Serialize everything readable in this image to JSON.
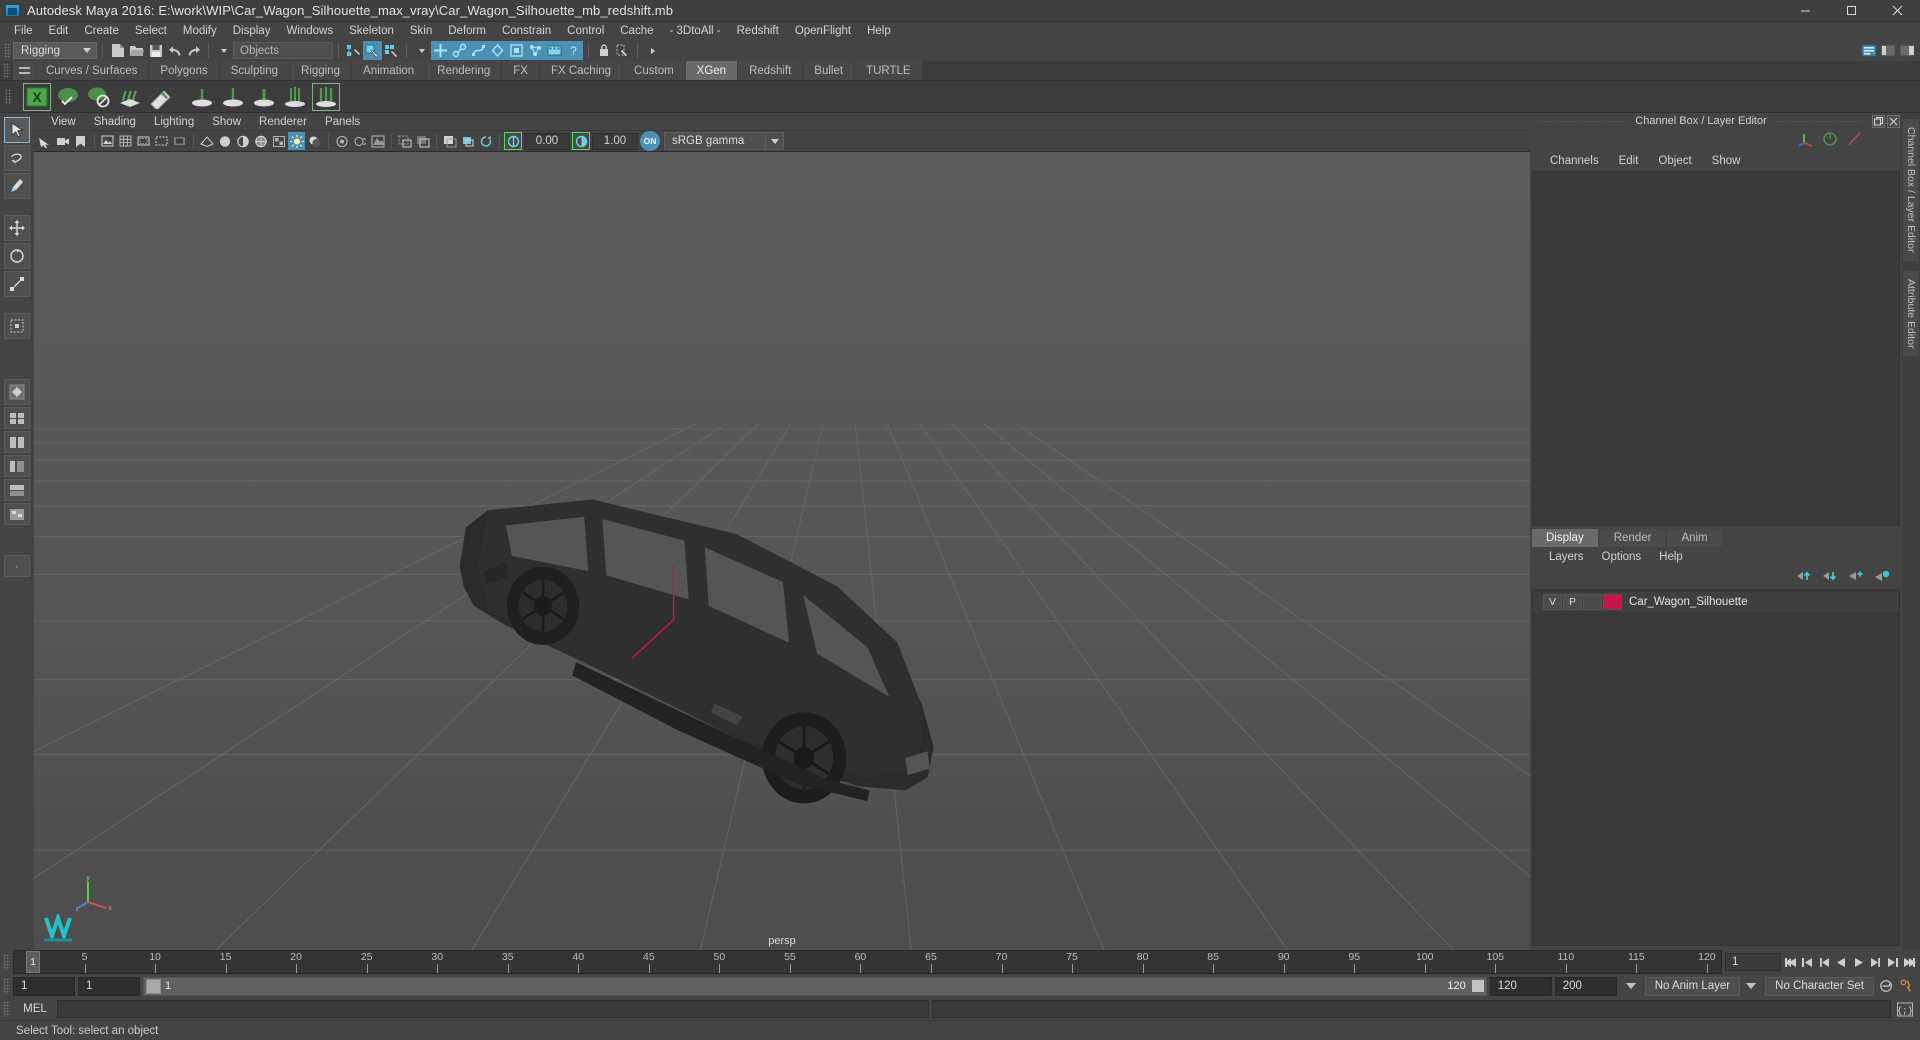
{
  "window": {
    "title": "Autodesk Maya 2016: E:\\work\\WIP\\Car_Wagon_Silhouette_max_vray\\Car_Wagon_Silhouette_mb_redshift.mb",
    "minimize": "minimize-button",
    "maximize": "maximize-button",
    "close": "close-button"
  },
  "menubar": {
    "items": [
      "File",
      "Edit",
      "Create",
      "Select",
      "Modify",
      "Display",
      "Windows",
      "Skeleton",
      "Skin",
      "Deform",
      "Constrain",
      "Control",
      "Cache",
      "- 3DtoAll -",
      "Redshift",
      "OpenFlight",
      "Help"
    ]
  },
  "toolbar": {
    "menuset": "Rigging",
    "selection_mask": "Objects"
  },
  "shelf": {
    "tabs": [
      "Curves / Surfaces",
      "Polygons",
      "Sculpting",
      "Rigging",
      "Animation",
      "Rendering",
      "FX",
      "FX Caching",
      "Custom",
      "XGen",
      "Redshift",
      "Bullet",
      "TURTLE"
    ],
    "active_tab": "XGen"
  },
  "viewport": {
    "menus": [
      "View",
      "Shading",
      "Lighting",
      "Show",
      "Renderer",
      "Panels"
    ],
    "exposure": "0.00",
    "gamma": "1.00",
    "cms_toggle": "ON",
    "color_profile": "sRGB gamma",
    "camera_label": "persp"
  },
  "right_dock": {
    "panel_title": "Channel Box / Layer Editor",
    "channel_tabs": [
      "Channels",
      "Edit",
      "Object",
      "Show"
    ],
    "layer_editor_tabs": [
      "Display",
      "Render",
      "Anim"
    ],
    "layer_editor_active_tab": "Display",
    "layer_menus": [
      "Layers",
      "Options",
      "Help"
    ],
    "layers": [
      {
        "visibility": "V",
        "playback": "P",
        "shading": "",
        "color": "#c8144b",
        "name": "Car_Wagon_Silhouette"
      }
    ],
    "vertical_tabs": [
      "Channel Box / Layer Editor",
      "Attribute Editor"
    ]
  },
  "timeline": {
    "ticks": [
      5,
      10,
      15,
      20,
      25,
      30,
      35,
      40,
      45,
      50,
      55,
      60,
      65,
      70,
      75,
      80,
      85,
      90,
      95,
      100,
      105,
      110,
      115,
      120
    ],
    "current_frame": "1",
    "current_frame_field": "1",
    "range_start": "1",
    "range_end": "1",
    "range_bar_start": "1",
    "range_bar_end": "120",
    "playback_end": "120",
    "anim_end": "200",
    "anim_layer": "No Anim Layer",
    "character_set": "No Character Set"
  },
  "command_line": {
    "label": "MEL",
    "input_value": "",
    "status": "Select Tool: select an object"
  }
}
